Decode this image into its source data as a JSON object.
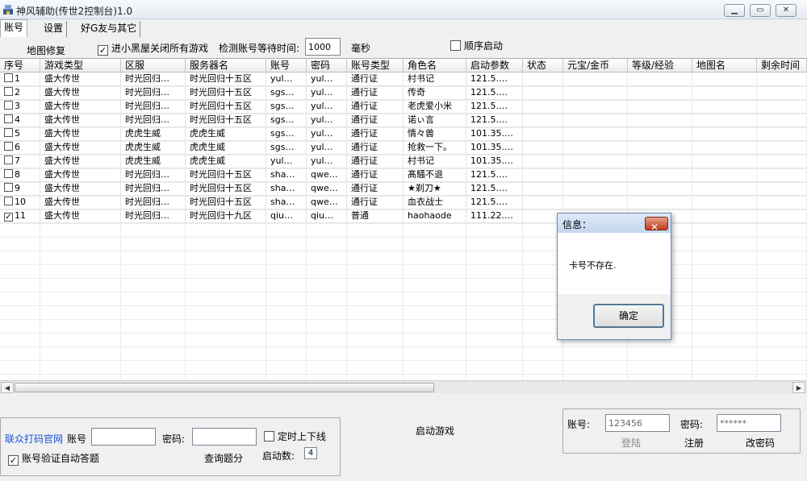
{
  "window": {
    "title": "神风辅助(传世2控制台)1.0"
  },
  "tabs": [
    {
      "label": "账号"
    },
    {
      "label": "设置"
    },
    {
      "label": "好G友与其它"
    }
  ],
  "options": {
    "map_repair": "地图修复",
    "close_games_label": "进小黑屋关闭所有游戏",
    "detect_wait_label": "检测账号等待时间:",
    "detect_wait_value": "1000",
    "detect_wait_unit": "毫秒",
    "sequential_start_label": "顺序启动"
  },
  "table": {
    "columns": [
      "序号",
      "游戏类型",
      "区服",
      "服务器名",
      "账号",
      "密码",
      "账号类型",
      "角色名",
      "启动参数",
      "状态",
      "元宝/金币",
      "等级/经验",
      "地图名",
      "剩余时间"
    ],
    "rows": [
      {
        "checked": false,
        "cells": [
          "1",
          "盛大传世",
          "时光回归…",
          "时光回归十五区",
          "yul…",
          "yul…",
          "通行证",
          "村书记",
          "121.5.…"
        ]
      },
      {
        "checked": false,
        "cells": [
          "2",
          "盛大传世",
          "时光回归…",
          "时光回归十五区",
          "sgs…",
          "yul…",
          "通行证",
          "传奇",
          "121.5.…"
        ]
      },
      {
        "checked": false,
        "cells": [
          "3",
          "盛大传世",
          "时光回归…",
          "时光回归十五区",
          "sgs…",
          "yul…",
          "通行证",
          "老虎爱小米",
          "121.5.…"
        ]
      },
      {
        "checked": false,
        "cells": [
          "4",
          "盛大传世",
          "时光回归…",
          "时光回归十五区",
          "sgs…",
          "yul…",
          "通行证",
          "诺ぃ言",
          "121.5.…"
        ]
      },
      {
        "checked": false,
        "cells": [
          "5",
          "盛大传世",
          "虎虎生威",
          "虎虎生威",
          "sgs…",
          "yul…",
          "通行证",
          "情々兽",
          "101.35.…"
        ]
      },
      {
        "checked": false,
        "cells": [
          "6",
          "盛大传世",
          "虎虎生威",
          "虎虎生威",
          "sgs…",
          "yul…",
          "通行证",
          "抢救一下。",
          "101.35.…"
        ]
      },
      {
        "checked": false,
        "cells": [
          "7",
          "盛大传世",
          "虎虎生威",
          "虎虎生威",
          "yul…",
          "yul…",
          "通行证",
          "村书记",
          "101.35.…"
        ]
      },
      {
        "checked": false,
        "cells": [
          "8",
          "盛大传世",
          "时光回归…",
          "时光回归十五区",
          "sha…",
          "qwe…",
          "通行证",
          "髙騒不退",
          "121.5.…"
        ]
      },
      {
        "checked": false,
        "cells": [
          "9",
          "盛大传世",
          "时光回归…",
          "时光回归十五区",
          "sha…",
          "qwe…",
          "通行证",
          "★剃刀★",
          "121.5.…"
        ]
      },
      {
        "checked": false,
        "cells": [
          "10",
          "盛大传世",
          "时光回归…",
          "时光回归十五区",
          "sha…",
          "qwe…",
          "通行证",
          "血衣战士",
          "121.5.…"
        ]
      },
      {
        "checked": true,
        "cells": [
          "11",
          "盛大传世",
          "时光回归…",
          "时光回归十九区",
          "qiu…",
          "qiu…",
          "普通",
          "haohaode",
          "111.22.…"
        ]
      }
    ]
  },
  "captcha": {
    "site_label": "联众打码官网",
    "account_label": "账号",
    "account_value": "",
    "password_label": "密码:",
    "password_value": "",
    "timed_label": "定时上下线",
    "auto_answer_label": "账号验证自动答题",
    "query_label": "查询题分",
    "start_count_label": "启动数:",
    "start_count_value": "4"
  },
  "launch_label": "启动游戏",
  "login": {
    "account_label": "账号:",
    "account_value": "123456",
    "password_label": "密码:",
    "password_value": "******",
    "login_label": "登陆",
    "register_label": "注册",
    "change_pw_label": "改密码"
  },
  "dialog": {
    "title": "信息：",
    "message": "卡号不存在.",
    "ok_label": "确定"
  },
  "colors": {
    "link": "#1d4fd8",
    "dialog_close": "#c2391c",
    "title_bar": "#e6ebf2"
  }
}
